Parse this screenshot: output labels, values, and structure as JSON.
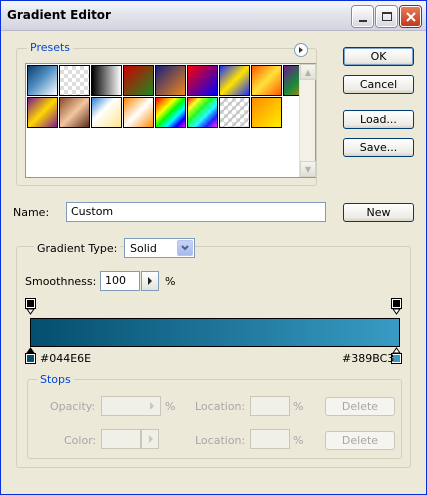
{
  "window": {
    "title": "Gradient Editor"
  },
  "buttons": {
    "ok": "OK",
    "cancel": "Cancel",
    "load": "Load...",
    "save": "Save...",
    "new": "New"
  },
  "presets": {
    "legend": "Presets",
    "swatches": [
      "linear-gradient(135deg,#0b3d6a 0%,#4f8fc2 45%,#ffffff 100%)",
      "checker-white",
      "linear-gradient(90deg,#000 0%,#fff 100%)",
      "linear-gradient(135deg,#cc0000 0%,#1f8a1f 100%)",
      "linear-gradient(135deg,#1b1f7a 0%,#f08a1a 100%)",
      "linear-gradient(135deg,#ff0000 0%,#0000ff 100%)",
      "linear-gradient(135deg,#1a2cff 0%,#ffe400 50%,#1a2cff 100%)",
      "linear-gradient(135deg,#ff5a00 0%,#ffe23a 50%,#ff5a00 100%)",
      "linear-gradient(135deg,#6a1a8a 0%,#1a8a3a 50%,#ff8a00 100%)",
      "linear-gradient(135deg,#7a1a8a 0%,#ffd800 50%,#7a1a8a 100%)",
      "linear-gradient(135deg,#8a4a2a 0%,#f3c6a0 50%,#5a2a1a 100%)",
      "linear-gradient(135deg,#2a7fd0 0%,#ffffff 40%,#ffe58a 100%)",
      "linear-gradient(135deg,#ff8a00 0%,#ffffff 50%,#ff8a00 100%)",
      "linear-gradient(135deg,#ff0000,#ff8000,#ffff00,#00ff00,#00ffff,#0000ff,#ff00ff)",
      "checker-rainbow",
      "checker-stripe",
      "linear-gradient(135deg,#ff8a00 0%,#ffef00 100%)"
    ]
  },
  "name_field": {
    "label": "Name:",
    "value": "Custom"
  },
  "gradient_type": {
    "label": "Gradient Type:",
    "value": "Solid"
  },
  "smoothness": {
    "label": "Smoothness:",
    "value": "100",
    "unit": "%"
  },
  "gradient": {
    "start_color": "#044E6E",
    "end_color": "#389BC3",
    "start_label": "#044E6E",
    "end_label": "#389BC3"
  },
  "stops": {
    "legend": "Stops",
    "opacity_label": "Opacity:",
    "opacity_unit": "%",
    "location_label": "Location:",
    "location_unit": "%",
    "color_label": "Color:",
    "delete_label": "Delete"
  }
}
